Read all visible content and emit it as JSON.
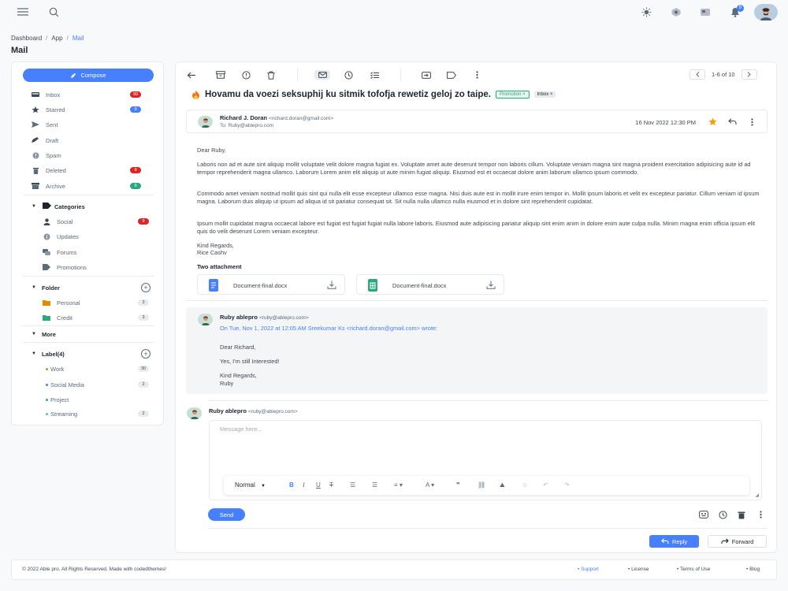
{
  "topbar": {
    "notif_count": "9",
    "icons": [
      "menu-icon",
      "search-icon",
      "sun-icon",
      "settings-icon",
      "monitor-icon",
      "bell-icon",
      "avatar"
    ]
  },
  "breadcrumb": {
    "items": [
      "Dashboard",
      "App",
      "Mail"
    ]
  },
  "page_title": "Mail",
  "sidebar": {
    "compose": "Compose",
    "items": [
      {
        "label": "Inbox",
        "count": "99",
        "color": "#dc2626"
      },
      {
        "label": "Starred",
        "count": "9",
        "color": "#4680ff"
      },
      {
        "label": "Sent",
        "count": ""
      },
      {
        "label": "Draft",
        "count": ""
      },
      {
        "label": "Spam",
        "count": ""
      },
      {
        "label": "Deleted",
        "count": "9",
        "color": "#dc2626"
      },
      {
        "label": "Archive",
        "count": "9",
        "color": "#2ca87f"
      }
    ],
    "categories": {
      "title": "Categories",
      "items": [
        {
          "label": "Social",
          "count": "9"
        },
        {
          "label": "Updates",
          "count": ""
        },
        {
          "label": "Forums",
          "count": ""
        },
        {
          "label": "Promotions",
          "count": ""
        }
      ]
    },
    "folder": {
      "title": "Folder",
      "items": [
        {
          "label": "Personal",
          "count": "3"
        },
        {
          "label": "Credit",
          "count": "3"
        }
      ]
    },
    "more": "More",
    "labels": {
      "title": "Label(4)",
      "items": [
        {
          "label": "Work",
          "count": "30",
          "color": "#e58a00"
        },
        {
          "label": "Social Media",
          "count": "2",
          "color": "#4680ff"
        },
        {
          "label": "Project",
          "count": "",
          "color": "#2ca87f"
        },
        {
          "label": "Streaming",
          "count": "2",
          "color": "#3ec9d6"
        }
      ]
    }
  },
  "pager": {
    "text": "1-6 of 10"
  },
  "mail": {
    "subject": "Hovamu da voezi seksuphij ku sitmik tofofja rewetiz geloj zo taipe.",
    "tags": [
      "Promotion",
      "Inbox"
    ],
    "from_name": "Richard J. Doran",
    "from_email": "<richard.doran@gmail.com>",
    "to": "To: Ruby@ablepro.com",
    "date": "16 Nov 2022 12:30 PM",
    "greeting": "Dear Ruby,",
    "paragraphs": [
      "Laboris non ad et aute sint aliquip mollit voluptate velit dolore magna fugiat ex. Voluptate amet aute deserunt tempor non laboris cillum. Voluptate veniam magna sint magna proident exercitation adipisicing aute id ad tempor reprehenderit magna ullamco. Laborum Lorem anim elit aliquip ut aute minim fugiat aliquip. Eiusmod est et occaecat dolore anim laborum ullamco ipsum commodo.",
      "Commodo amet veniam nostrud mollit quis sint qui nulla elit esse excepteur ullamco esse magna. Nisi duis aute est in mollit irure enim tempor in. Mollit ipsum laboris et velit ex excepteur pariatur. Cillum veniam id ipsum magna. Laborum duis aliquip ut ipsum ad aliqua id sit pariatur consequat sit. Sit nulla nulla ullamco nulla eiusmod et in dolore sint reprehenderit cupidatat.",
      "Ipsum mollit cupidatat magna occaecat labore est fugiat est fugiat fugiat nulla labore laboris. Eiusmod aute adipisicing pariatur aliquip sint enim anim in dolore enim aute culpa nulla. Minim magna enim officia ipsum elit quis do velit deserunt Lorem veniam excepteur."
    ],
    "sign_1": "Kind Regards,",
    "sign_2": "Rice Cashv",
    "attach_title": "Two attachment",
    "attachments": [
      "Document-final.docx",
      "Document-final.docx"
    ]
  },
  "thread": {
    "name": "Ruby ablepro",
    "email": "<ruby@ablepro.com>",
    "quote_header": "On Tue, Nov 1, 2022 at 12:05 AM Sreekumar Ks <richard.doran@gmail.com> wrote:",
    "lines": [
      "Dear Richard,",
      "Yes, I'm still Interested!",
      "Kind Regards,",
      "Ruby"
    ]
  },
  "reply": {
    "name": "Ruby ablepro",
    "email": "<ruby@ablepro.com>",
    "placeholder": "Message here...",
    "style_select": "Normal",
    "send": "Send"
  },
  "actions": {
    "reply": "Reply",
    "forward": "Forward"
  },
  "footer": {
    "copyright": "© 2022 Able pro. All Rights Reserved. Made with codedthemes!",
    "links": [
      "Support",
      "License",
      "Terms of Use",
      "Blog"
    ]
  }
}
